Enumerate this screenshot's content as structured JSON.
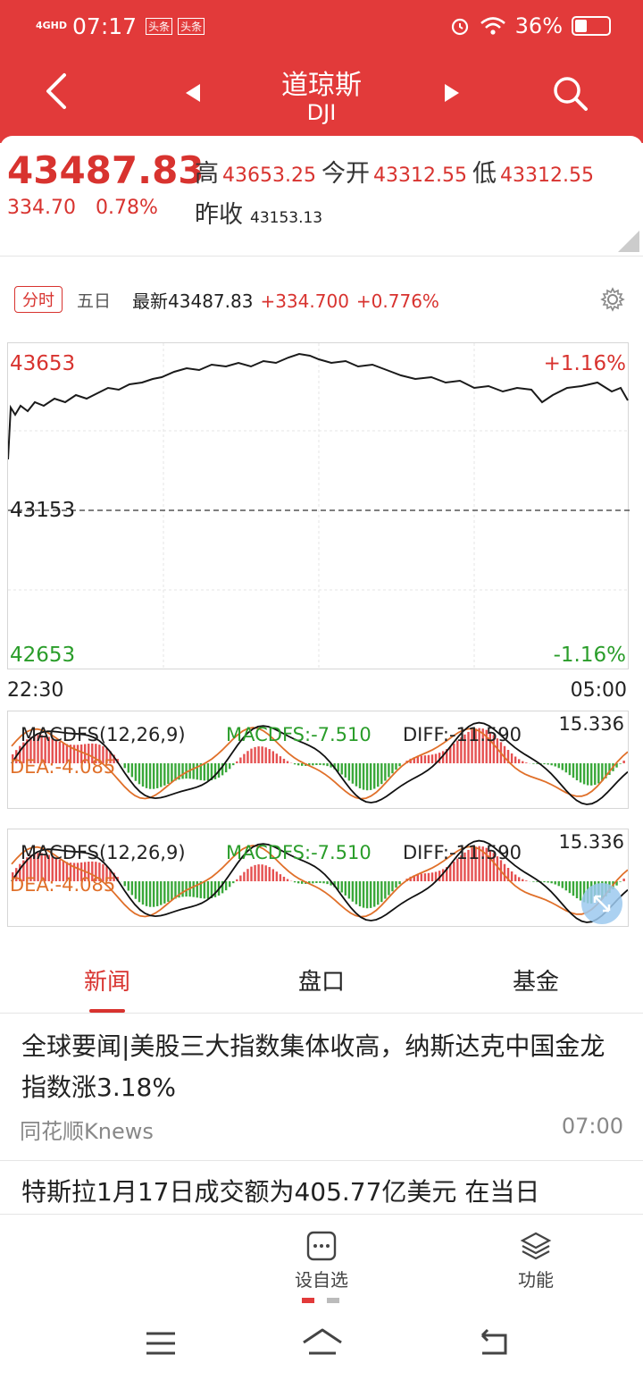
{
  "status": {
    "network": "4GHD",
    "time": "07:17",
    "apps": [
      "头条",
      "头条"
    ],
    "battery": "36%",
    "battery_level": 0.36
  },
  "header": {
    "title": "道琼斯",
    "subtitle": "DJI"
  },
  "quote": {
    "price": "43487.83",
    "change": "334.70",
    "change_pct": "0.78%",
    "high_label": "高",
    "high": "43653.25",
    "open_label": "今开",
    "open": "43312.55",
    "low_label": "低",
    "low": "43312.55",
    "prev_close_label": "昨收",
    "prev_close": "43153.13"
  },
  "tabs": {
    "intraday": "分时",
    "five_day": "五日",
    "latest_label": "最新43487.83",
    "latest_change": "+334.700",
    "latest_pct": "+0.776%"
  },
  "chart": {
    "y_high": "43653",
    "y_mid": "43153",
    "y_low": "42653",
    "pct_high": "+1.16%",
    "pct_low": "-1.16%",
    "time_start": "22:30",
    "time_end": "05:00"
  },
  "macd": {
    "title": "MACDFS(12,26,9)",
    "dea_label": "DEA:-4.085",
    "macdfs": "MACDFS:-7.510",
    "diff": "DIFF:-11.590",
    "max": "15.336"
  },
  "news_tabs": [
    "新闻",
    "盘口",
    "基金"
  ],
  "news": [
    {
      "title": "全球要闻|美股三大指数集体收高，纳斯达克中国金龙指数涨3.18%",
      "source": "同花顺Knews",
      "time": "07:00"
    },
    {
      "title": "特斯拉1月17日成交额为405.77亿美元 在当日"
    }
  ],
  "toolbar": {
    "add_watch": "设自选",
    "functions": "功能"
  },
  "colors": {
    "brand": "#e23a3a",
    "up": "#d8332f",
    "down": "#2a9d2a"
  }
}
